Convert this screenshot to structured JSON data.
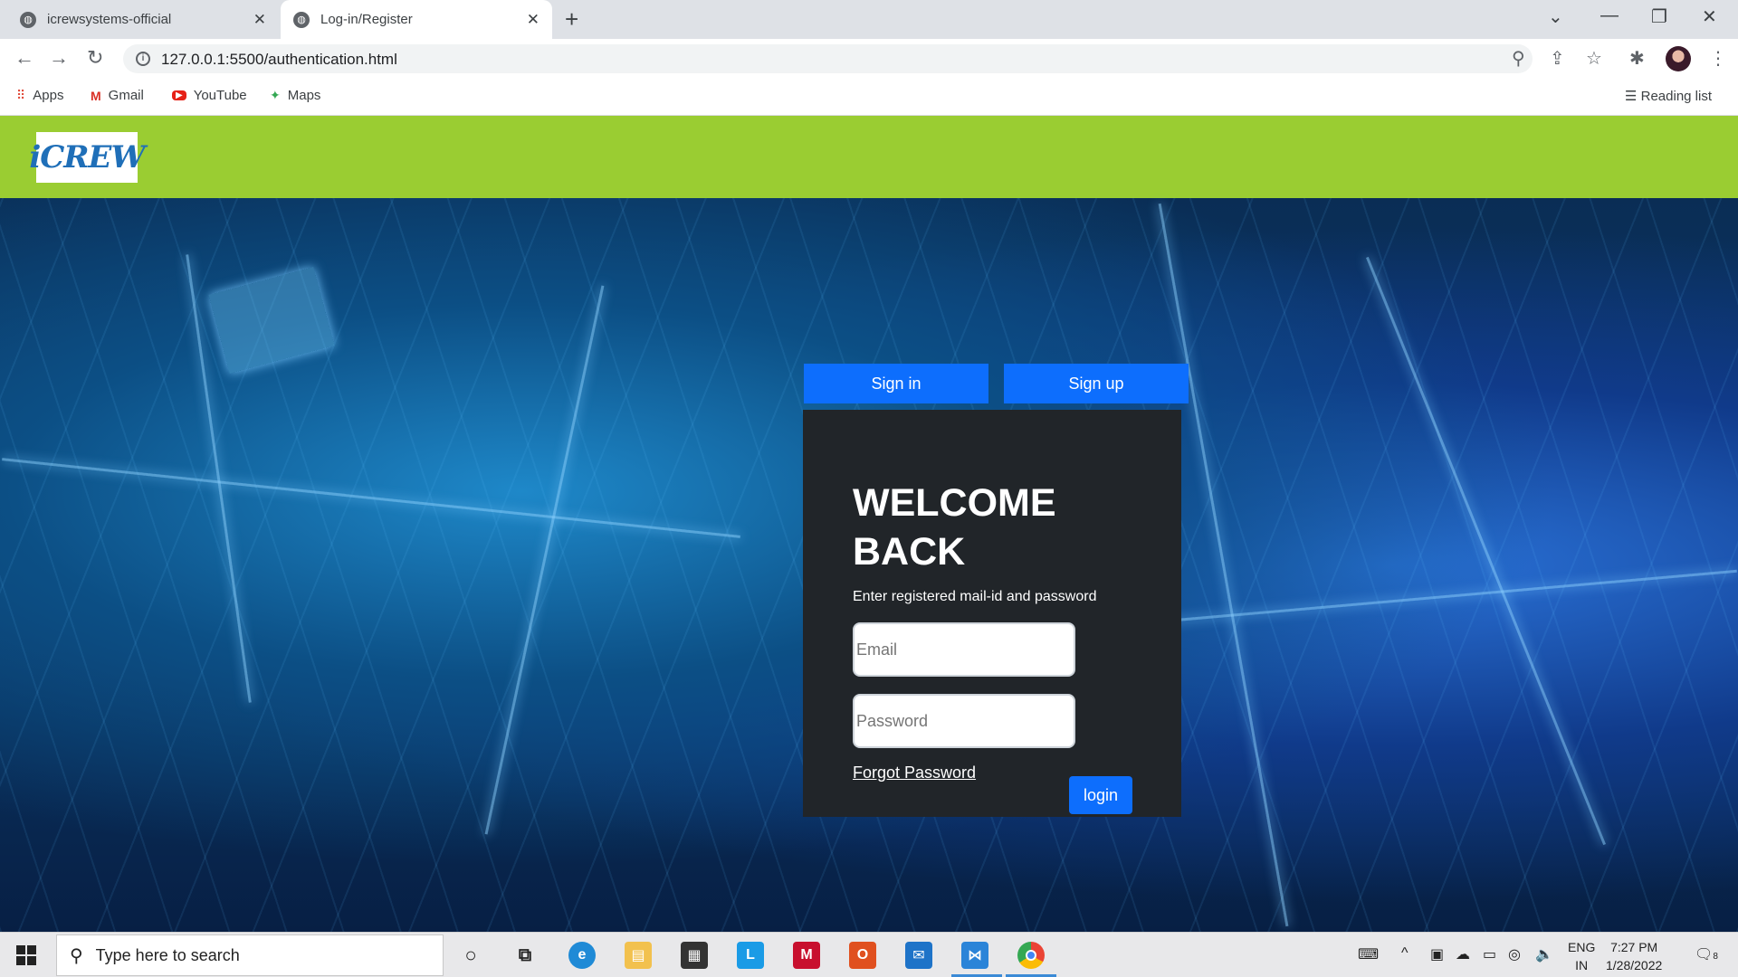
{
  "browser": {
    "tabs": [
      {
        "title": "icrewsystems-official",
        "active": false
      },
      {
        "title": "Log-in/Register",
        "active": true
      }
    ],
    "url": "127.0.0.1:5500/authentication.html",
    "bookmarks": [
      {
        "label": "Apps",
        "icon": "apps-grid-icon"
      },
      {
        "label": "Gmail",
        "icon": "gmail-icon"
      },
      {
        "label": "YouTube",
        "icon": "youtube-icon"
      },
      {
        "label": "Maps",
        "icon": "maps-icon"
      }
    ],
    "reading_list": "Reading list"
  },
  "site": {
    "logo_text": "iCREW",
    "header_color": "#9acd32",
    "tabs": {
      "signin": "Sign in",
      "signup": "Sign up"
    },
    "form": {
      "title": "WELCOME BACK",
      "subtitle": "Enter registered mail-id and password",
      "email_placeholder": "Email",
      "password_placeholder": "Password",
      "forgot": "Forgot Password",
      "submit": "login"
    },
    "accent": "#0d6efd"
  },
  "taskbar": {
    "search_placeholder": "Type here to search",
    "lang": {
      "line1": "ENG",
      "line2": "IN"
    },
    "time": "7:27 PM",
    "date": "1/28/2022",
    "notifications": "8"
  }
}
